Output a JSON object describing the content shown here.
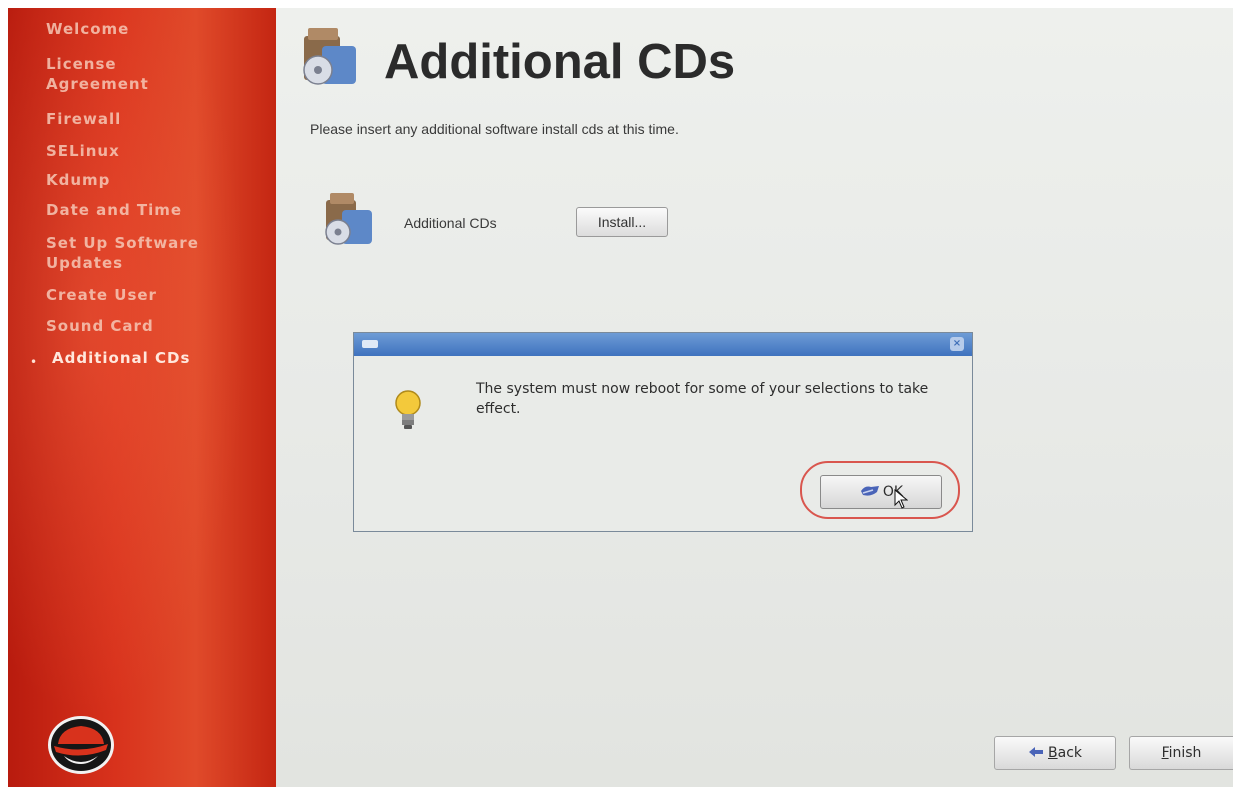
{
  "sidebar": {
    "items": [
      {
        "label": "Welcome"
      },
      {
        "label": "License"
      },
      {
        "label": "Agreement"
      },
      {
        "label": "Firewall"
      },
      {
        "label": "SELinux"
      },
      {
        "label": "Kdump"
      },
      {
        "label": "Date and Time"
      },
      {
        "label": "Set Up Software"
      },
      {
        "label": "Updates"
      },
      {
        "label": "Create User"
      },
      {
        "label": "Sound Card"
      },
      {
        "label": "Additional CDs"
      }
    ],
    "active_bullet": "•",
    "logo": "redhat-shadowman-logo"
  },
  "main": {
    "title": "Additional CDs",
    "subtitle": "Please insert any additional software install cds at this time.",
    "cd_row": {
      "label": "Additional CDs",
      "button_label": "Install..."
    }
  },
  "dialog": {
    "message": "The system must now reboot for some of your selections to take effect.",
    "ok_label": "OK",
    "close_glyph": "×",
    "icon": "lightbulb-icon",
    "highlight_color": "#d9564e"
  },
  "footer": {
    "back_mnemonic": "B",
    "back_rest": "ack",
    "finish_mnemonic": "F",
    "finish_rest": "inish"
  },
  "colors": {
    "sidebar_red": "#d8321c",
    "titlebar_blue": "#3f72be",
    "background": "#e7e9e6"
  }
}
